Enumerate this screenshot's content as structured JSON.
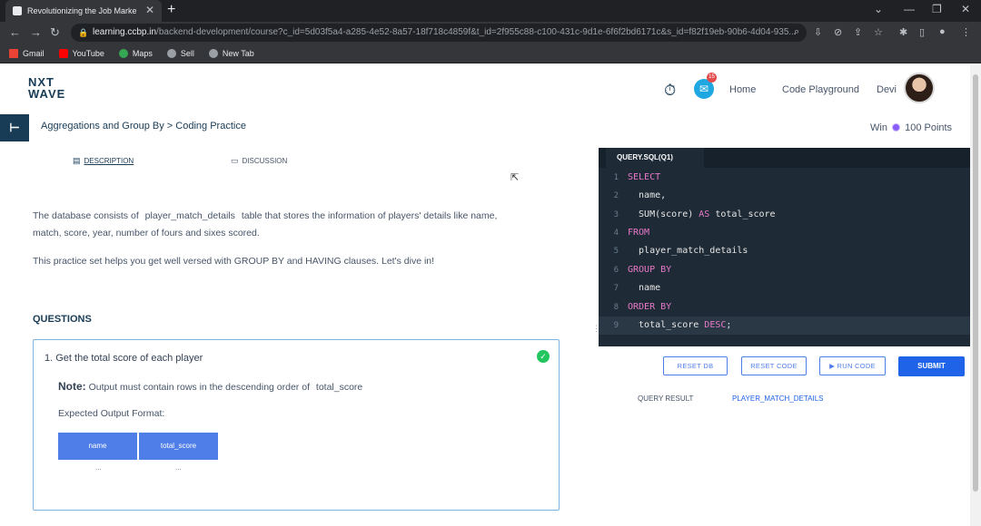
{
  "browser": {
    "tab_title": "Revolutionizing the Job Market | NxtWave",
    "url_host": "learning.ccbp.in",
    "url_path": "/backend-development/course?c_id=5d03f5a4-a285-4e52-8a57-18f718c4859f&t_id=2f955c88-c100-431c-9d1e-6f6f2bd6171c&s_id=f82f19eb-90b6-4d04-935...",
    "bookmarks": [
      "Gmail",
      "YouTube",
      "Maps",
      "Sell",
      "New Tab"
    ]
  },
  "header": {
    "logo_line1": "NXT",
    "logo_line2": "WAVE",
    "notification_count": "15",
    "nav": [
      "Home",
      "Code Playground",
      "Devi"
    ]
  },
  "breadcrumb": "Aggregations and Group By > Coding Practice",
  "win_points": {
    "prefix": "Win",
    "points": "100 Points"
  },
  "tabs": {
    "description": "DESCRIPTION",
    "discussion": "DISCUSSION"
  },
  "description": {
    "para1_a": "The database consists of",
    "para1_code": "player_match_details",
    "para1_b": "table that stores the information of players' details like name,",
    "para1_c": "match, score, year, number of fours and sixes scored.",
    "para2": "This practice set helps you get well versed with GROUP BY and HAVING clauses. Let's dive in!"
  },
  "questions": {
    "heading": "QUESTIONS",
    "q1": "1.  Get the total score of each player",
    "note_label": "Note:",
    "note_text": "Output must contain rows in the descending order of",
    "note_code": "total_score",
    "expected_label": "Expected Output Format:",
    "columns": [
      "name",
      "total_score"
    ],
    "ellipsis": "..."
  },
  "editor": {
    "tab": "QUERY.SQL(Q1)",
    "lines": [
      {
        "n": "1",
        "kw": "SELECT",
        "rest": ""
      },
      {
        "n": "2",
        "kw": "",
        "rest": "  name,"
      },
      {
        "n": "3",
        "kw": "",
        "rest": "  SUM(score) AS total_score"
      },
      {
        "n": "4",
        "kw": "FROM",
        "rest": ""
      },
      {
        "n": "5",
        "kw": "",
        "rest": "  player_match_details"
      },
      {
        "n": "6",
        "kw": "GROUP BY",
        "rest": ""
      },
      {
        "n": "7",
        "kw": "",
        "rest": "  name"
      },
      {
        "n": "8",
        "kw": "ORDER BY",
        "rest": ""
      },
      {
        "n": "9",
        "kw": "",
        "rest": "  total_score DESC;"
      }
    ]
  },
  "buttons": {
    "reset_db": "RESET DB",
    "reset_code": "RESET CODE",
    "run_code": "RUN CODE",
    "submit": "SUBMIT"
  },
  "result_tabs": [
    "QUERY RESULT",
    "PLAYER_MATCH_DETAILS"
  ],
  "colors": {
    "accent": "#1e63e8",
    "brand": "#183b56",
    "editor_bg": "#1e2a35",
    "keyword": "#e879c9"
  }
}
